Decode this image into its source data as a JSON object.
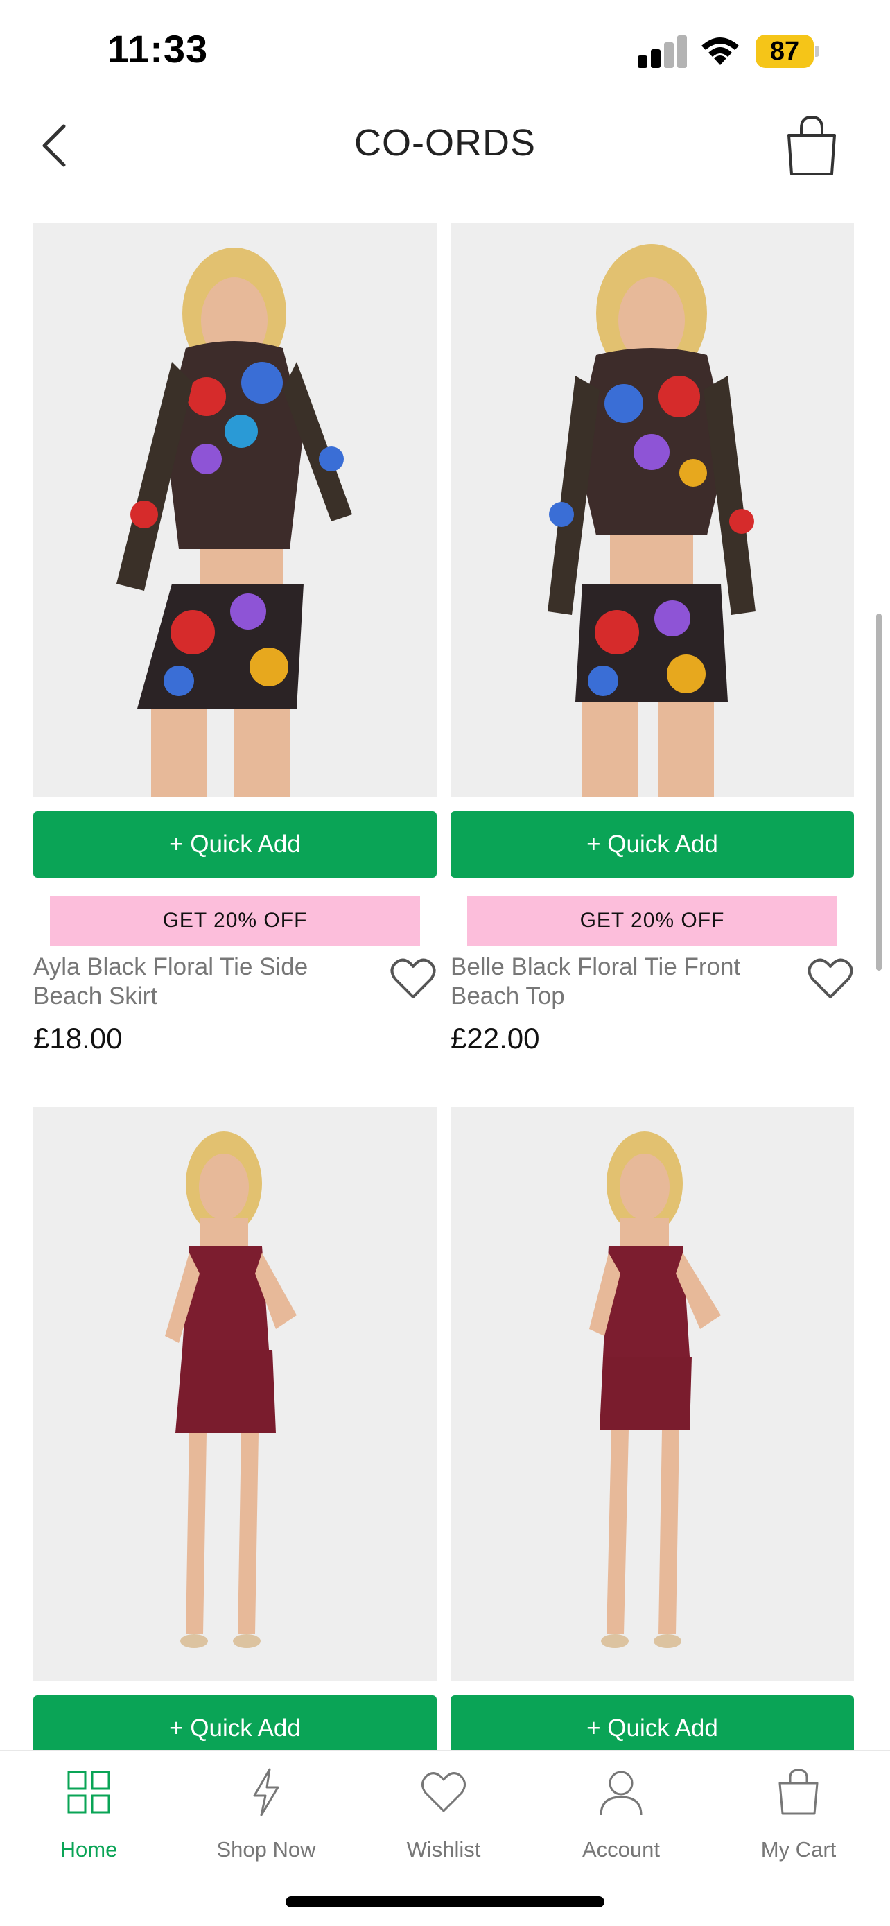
{
  "status_bar": {
    "time": "11:33",
    "battery_level": "87",
    "battery_color": "#f5c518"
  },
  "header": {
    "title": "CO-ORDS",
    "back_icon": "chevron-left-icon",
    "cart_icon": "shopping-bag-icon"
  },
  "products": [
    {
      "name": "Ayla Black Floral Tie Side Beach Skirt",
      "price": "£18.00",
      "quick_add_label": "+ Quick Add",
      "promo": "GET 20% OFF",
      "image_description": "floral print mesh top and mini skirt"
    },
    {
      "name": "Belle Black Floral Tie Front Beach Top",
      "price": "£22.00",
      "quick_add_label": "+ Quick Add",
      "promo": "GET 20% OFF",
      "image_description": "floral print mesh top and mini skirt"
    },
    {
      "quick_add_label": "+ Quick Add",
      "image_description": "burgundy strapless corset top and mini skirt"
    },
    {
      "quick_add_label": "+ Quick Add",
      "image_description": "burgundy strapless corset top and mini skirt"
    }
  ],
  "tab_bar": {
    "tabs": [
      {
        "label": "Home",
        "icon": "grid-icon",
        "active": true
      },
      {
        "label": "Shop Now",
        "icon": "lightning-icon",
        "active": false
      },
      {
        "label": "Wishlist",
        "icon": "heart-icon",
        "active": false
      },
      {
        "label": "Account",
        "icon": "person-icon",
        "active": false
      },
      {
        "label": "My Cart",
        "icon": "shopping-bag-icon",
        "active": false
      }
    ]
  },
  "colors": {
    "accent": "#0aa456",
    "promo_bg": "#fcbedb",
    "price_text": "#111111",
    "name_text": "#777777"
  }
}
